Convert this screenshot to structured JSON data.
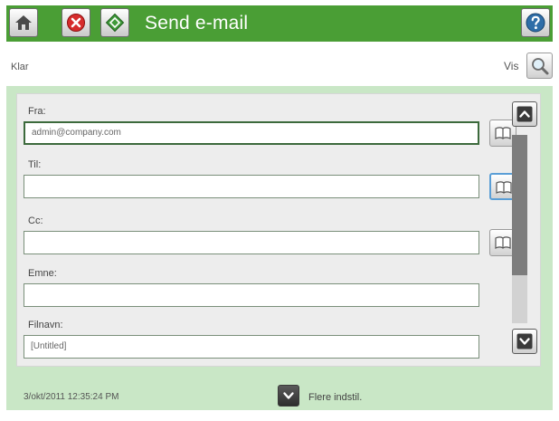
{
  "header": {
    "title": "Send e-mail",
    "home_icon": "home-icon",
    "stop_icon": "stop-icon",
    "start_icon": "start-icon",
    "help_icon": "help-icon",
    "background": "#4a9e35"
  },
  "status": {
    "text": "Klar",
    "view_label": "Vis",
    "view_icon": "magnifier-icon"
  },
  "form": {
    "fields": [
      {
        "label": "Fra:",
        "value": "admin@company.com"
      },
      {
        "label": "Til:",
        "value": ""
      },
      {
        "label": "Cc:",
        "value": ""
      },
      {
        "label": "Emne:",
        "value": ""
      },
      {
        "label": "Filnavn:",
        "value": "[Untitled]"
      }
    ],
    "address_book_icon": "address-book-icon"
  },
  "scrollbar": {
    "up_icon": "chevron-up-icon",
    "down_icon": "chevron-down-icon",
    "position": 0
  },
  "footer": {
    "timestamp": "3/okt/2011 12:35:24 PM",
    "more_options_label": "Flere indstil.",
    "more_options_icon": "chevron-down-icon"
  }
}
